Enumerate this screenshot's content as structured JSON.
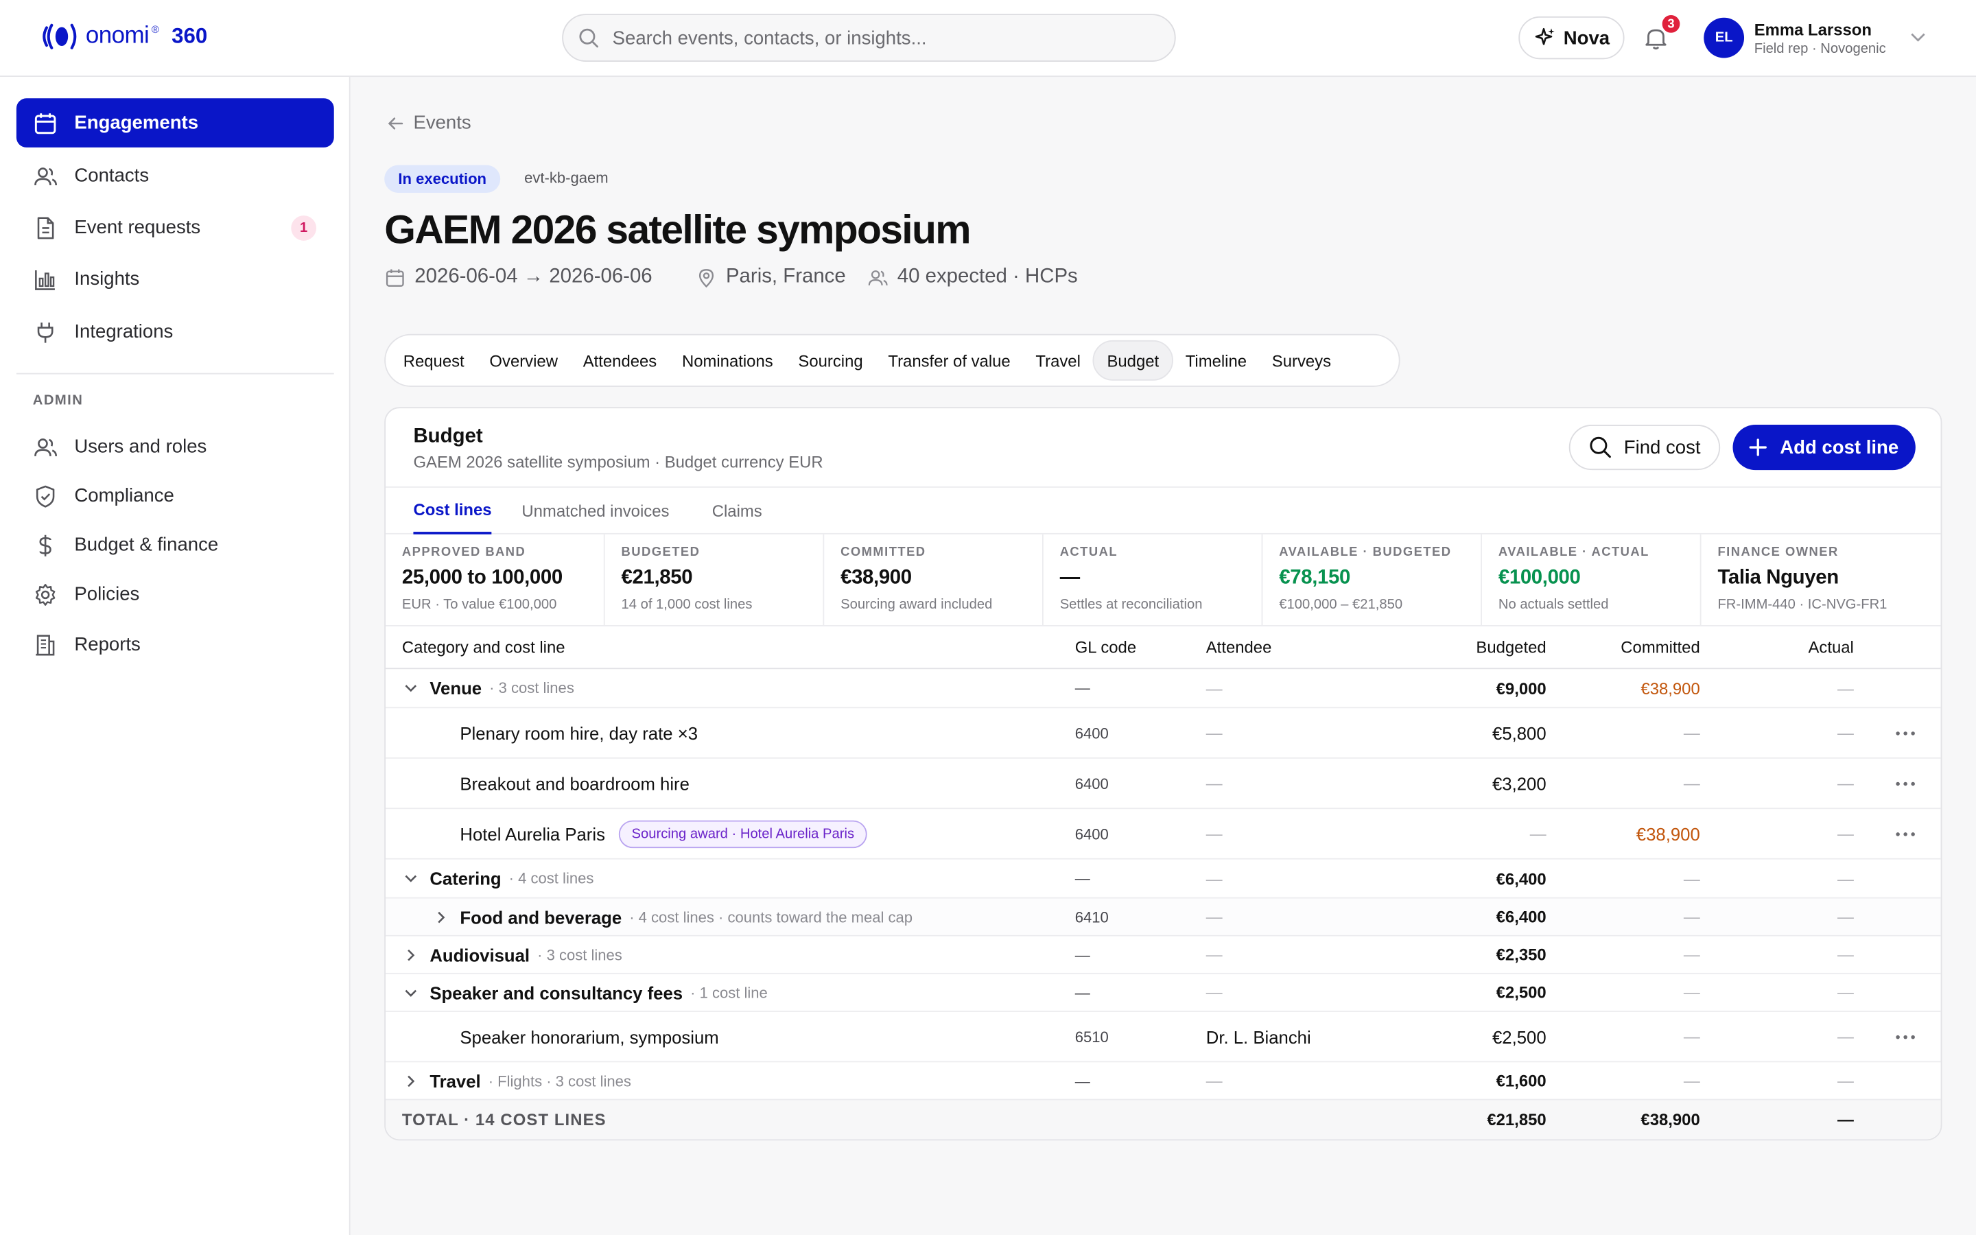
{
  "app": {
    "logo_word": "onomi",
    "logo_mark": "®",
    "logo_suffix": "360"
  },
  "search": {
    "placeholder": "Search events, contacts, or insights..."
  },
  "header": {
    "assistant_label": "Nova",
    "notifications_count": "3",
    "user": {
      "initials": "EL",
      "name": "Emma Larsson",
      "role": "Field rep · Novogenic"
    }
  },
  "sidebar": {
    "items": [
      {
        "label": "Engagements",
        "icon": "calendar-icon"
      },
      {
        "label": "Contacts",
        "icon": "users-icon"
      },
      {
        "label": "Event requests",
        "icon": "document-icon",
        "count": "1"
      },
      {
        "label": "Insights",
        "icon": "bar-chart-icon"
      },
      {
        "label": "Integrations",
        "icon": "plug-icon"
      }
    ],
    "admin_label": "ADMIN",
    "admin_items": [
      {
        "label": "Users and roles",
        "icon": "users-icon"
      },
      {
        "label": "Compliance",
        "icon": "shield-icon"
      },
      {
        "label": "Budget & finance",
        "icon": "dollar-icon"
      },
      {
        "label": "Policies",
        "icon": "gear-icon"
      },
      {
        "label": "Reports",
        "icon": "building-icon"
      }
    ]
  },
  "event": {
    "back_label": "Events",
    "status": "In execution",
    "code": "evt-kb-gaem",
    "title": "GAEM 2026 satellite symposium",
    "dates": "2026-06-04 → 2026-06-06",
    "location": "Paris, France",
    "audience": "40 expected · HCPs"
  },
  "tabs": [
    "Request",
    "Overview",
    "Attendees",
    "Nominations",
    "Sourcing",
    "Transfer of value",
    "Travel",
    "Budget",
    "Timeline",
    "Surveys"
  ],
  "active_tab": "Budget",
  "budget": {
    "title": "Budget",
    "subtitle": "GAEM 2026 satellite symposium · Budget currency EUR",
    "find_label": "Find cost",
    "add_label": "Add cost line",
    "subtabs": [
      "Cost lines",
      "Unmatched invoices",
      "Claims"
    ],
    "stats": [
      {
        "label": "Approved band",
        "value": "25,000 to 100,000",
        "note": "EUR · To value €100,000"
      },
      {
        "label": "Budgeted",
        "value": "€21,850",
        "note": "14 of 1,000 cost lines"
      },
      {
        "label": "Committed",
        "value": "€38,900",
        "note": "Sourcing award included"
      },
      {
        "label": "Actual",
        "value": "—",
        "note": "Settles at reconciliation"
      },
      {
        "label": "Available · budgeted",
        "value": "€78,150",
        "note": "€100,000 – €21,850"
      },
      {
        "label": "Available · actual",
        "value": "€100,000",
        "note": "No actuals settled"
      },
      {
        "label": "Finance owner",
        "value": "Talia Nguyen",
        "note": "FR-IMM-440 · IC-NVG-FR1"
      }
    ],
    "columns": {
      "category": "Category and cost line",
      "gl": "GL code",
      "attendee": "Attendee",
      "budgeted": "Budgeted",
      "committed": "Committed",
      "actual": "Actual"
    },
    "rows": [
      {
        "name": "Venue",
        "note": "· 3 cost lines",
        "gl": "—",
        "attendee": "—",
        "budgeted": "€9,000",
        "committed": "€38,900",
        "actual": "—"
      },
      {
        "name": "Plenary room hire, day rate ×3",
        "gl": "6400",
        "attendee": "—",
        "budgeted": "€5,800",
        "committed": "—",
        "actual": "—"
      },
      {
        "name": "Breakout and boardroom hire",
        "gl": "6400",
        "attendee": "—",
        "budgeted": "€3,200",
        "committed": "—",
        "actual": "—"
      },
      {
        "name": "Hotel Aurelia Paris",
        "badge": "Sourcing award · Hotel Aurelia Paris",
        "gl": "6400",
        "attendee": "—",
        "budgeted": "—",
        "committed": "€38,900",
        "actual": "—"
      },
      {
        "name": "Catering",
        "note": "· 4 cost lines",
        "gl": "—",
        "attendee": "—",
        "budgeted": "€6,400",
        "committed": "—",
        "actual": "—"
      },
      {
        "name": "Food and beverage",
        "note": "· 4 cost lines · counts toward the meal cap",
        "gl": "6410",
        "attendee": "—",
        "budgeted": "€6,400",
        "committed": "—",
        "actual": "—"
      },
      {
        "name": "Audiovisual",
        "note": "· 3 cost lines",
        "gl": "—",
        "attendee": "—",
        "budgeted": "€2,350",
        "committed": "—",
        "actual": "—"
      },
      {
        "name": "Speaker and consultancy fees",
        "note": "· 1 cost line",
        "gl": "—",
        "attendee": "—",
        "budgeted": "€2,500",
        "committed": "—",
        "actual": "—"
      },
      {
        "name": "Speaker honorarium, symposium",
        "gl": "6510",
        "attendee": "Dr. L. Bianchi",
        "budgeted": "€2,500",
        "committed": "—",
        "actual": "—"
      },
      {
        "name": "Travel",
        "note": "· Flights · 3 cost lines",
        "gl": "—",
        "attendee": "—",
        "budgeted": "€1,600",
        "committed": "—",
        "actual": "—"
      }
    ],
    "total": {
      "label": "TOTAL · 14 COST LINES",
      "budgeted": "€21,850",
      "committed": "€38,900",
      "actual": "—"
    }
  },
  "colors": {
    "brand": "#0a16c8",
    "positive": "#07924f",
    "committed": "#c2560c",
    "badge_purple": "#6a23c9",
    "notification": "#e0213c"
  }
}
